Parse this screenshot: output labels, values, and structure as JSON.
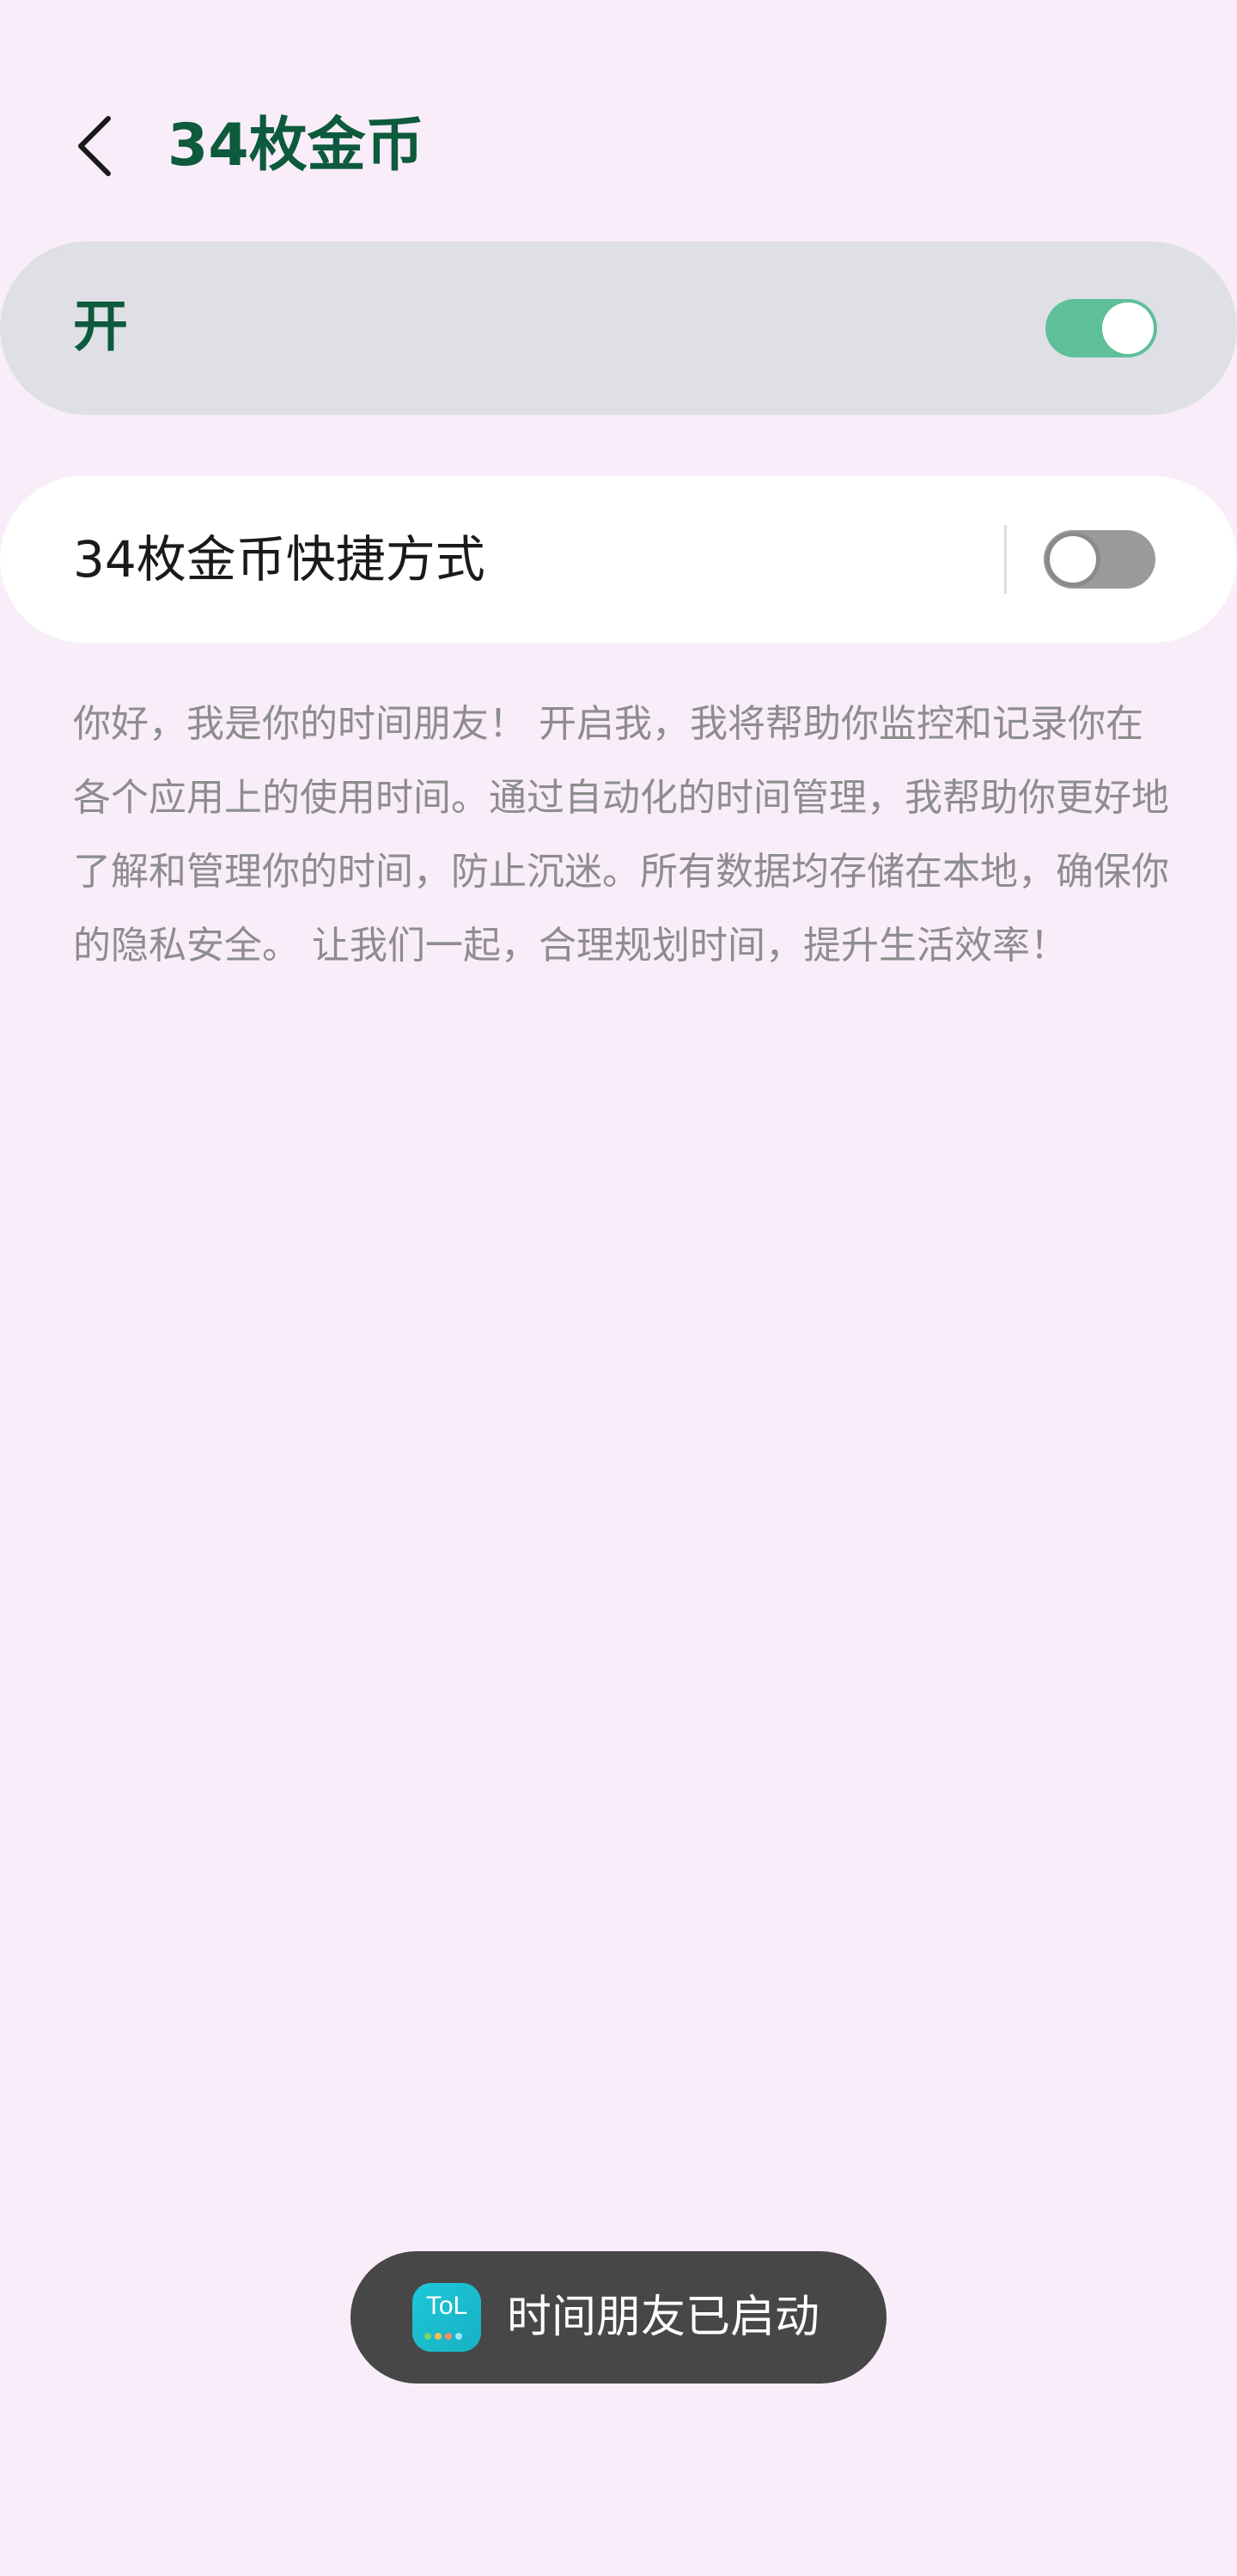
{
  "header": {
    "title": "34枚金币"
  },
  "master_switch": {
    "label": "开",
    "state": "on"
  },
  "shortcut": {
    "label": "34枚金币快捷方式",
    "state": "off"
  },
  "description": "你好，我是你的时间朋友！ 开启我，我将帮助你监控和记录你在各个应用上的使用时间。通过自动化的时间管理，我帮助你更好地了解和管理你的时间，防止沉迷。所有数据均存储在本地，确保你的隐私安全。 让我们一起，合理规划时间，提升生活效率！",
  "toast": {
    "message": "时间朋友已启动",
    "app_icon_text": "ToL"
  },
  "colors": {
    "background": "#f8edf9",
    "accent_green": "#0d5a3c",
    "toggle_on": "#5fbf99",
    "toggle_off": "#9a9a9a",
    "toast_bg": "#474747"
  }
}
